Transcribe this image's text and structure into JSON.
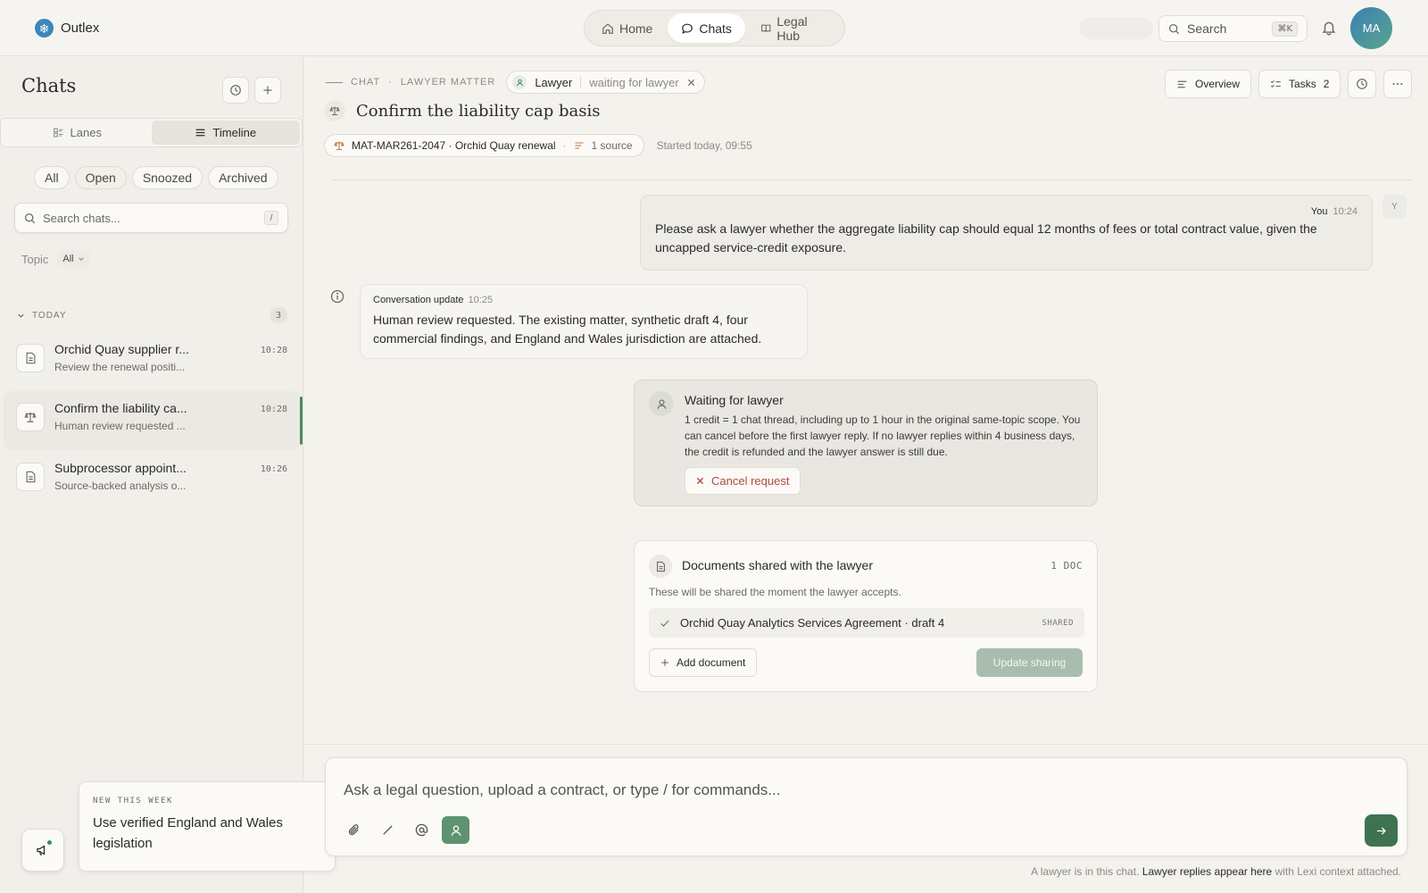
{
  "app": {
    "name": "Outlex",
    "logo_icon": "snowflake-logo-icon",
    "accent_color": "#3f7350"
  },
  "nav": {
    "home": "Home",
    "chats": "Chats",
    "legal_hub": "Legal Hub",
    "active": "chats"
  },
  "topbar": {
    "search_label": "Search",
    "search_shortcut": "⌘K",
    "user_initials": "MA"
  },
  "sidebar": {
    "title": "Chats",
    "view_tabs": [
      "Lanes",
      "Timeline"
    ],
    "active_view": "Timeline",
    "filters": [
      "All",
      "Open",
      "Snoozed",
      "Archived"
    ],
    "active_filter": "Open",
    "search_placeholder": "Search chats...",
    "search_shortcut": "/",
    "topic_label": "Topic",
    "topic_value": "All",
    "group_label": "TODAY",
    "group_count": "3",
    "items": [
      {
        "title": "Orchid Quay supplier r...",
        "preview": "Review the renewal positi...",
        "time": "10:28",
        "icon": "document-icon"
      },
      {
        "title": "Confirm the liability ca...",
        "preview": "Human review requested ...",
        "time": "10:28",
        "icon": "scales-icon",
        "active": true
      },
      {
        "title": "Subprocessor appoint...",
        "preview": "Source-backed analysis o...",
        "time": "10:26",
        "icon": "document-icon"
      }
    ],
    "promo": {
      "kicker": "NEW THIS WEEK",
      "message": "Use verified England and Wales legislation"
    }
  },
  "header": {
    "crumb_chat": "CHAT",
    "crumb_matter": "LAWYER MATTER",
    "lawyer_label": "Lawyer",
    "lawyer_status": "waiting for lawyer",
    "overview": "Overview",
    "tasks": "Tasks",
    "tasks_count": "2",
    "title": "Confirm the liability cap basis",
    "matter": "MAT-MAR261-2047 · Orchid Quay renewal",
    "sources": "1 source",
    "started": "Started today, 09:55"
  },
  "messages": {
    "user": {
      "author": "You",
      "time": "10:24",
      "avatar": "Y",
      "text": "Please ask a lawyer whether the aggregate liability cap should equal 12 months of fees or total contract value, given the uncapped service-credit exposure."
    },
    "update": {
      "label": "Conversation update",
      "time": "10:25",
      "text": "Human review requested. The existing matter, synthetic draft 4, four commercial findings, and England and Wales jurisdiction are attached."
    },
    "waiting": {
      "title": "Waiting for lawyer",
      "text": "1 credit = 1 chat thread, including up to 1 hour in the original same-topic scope. You can cancel before the first lawyer reply. If no lawyer replies within 4 business days, the credit is refunded and the lawyer answer is still due.",
      "cancel": "Cancel request"
    },
    "documents": {
      "title": "Documents shared with the lawyer",
      "count": "1 DOC",
      "subtitle": "These will be shared the moment the lawyer accepts.",
      "doc_name": "Orchid Quay Analytics Services Agreement · draft 4",
      "doc_status": "SHARED",
      "add": "Add document",
      "update": "Update sharing"
    }
  },
  "composer": {
    "placeholder": "Ask a legal question, upload a contract, or type / for commands...",
    "footnote_pre": "A lawyer is in this chat.",
    "footnote_bold": "Lawyer replies appear here",
    "footnote_post": "with Lexi context attached."
  }
}
